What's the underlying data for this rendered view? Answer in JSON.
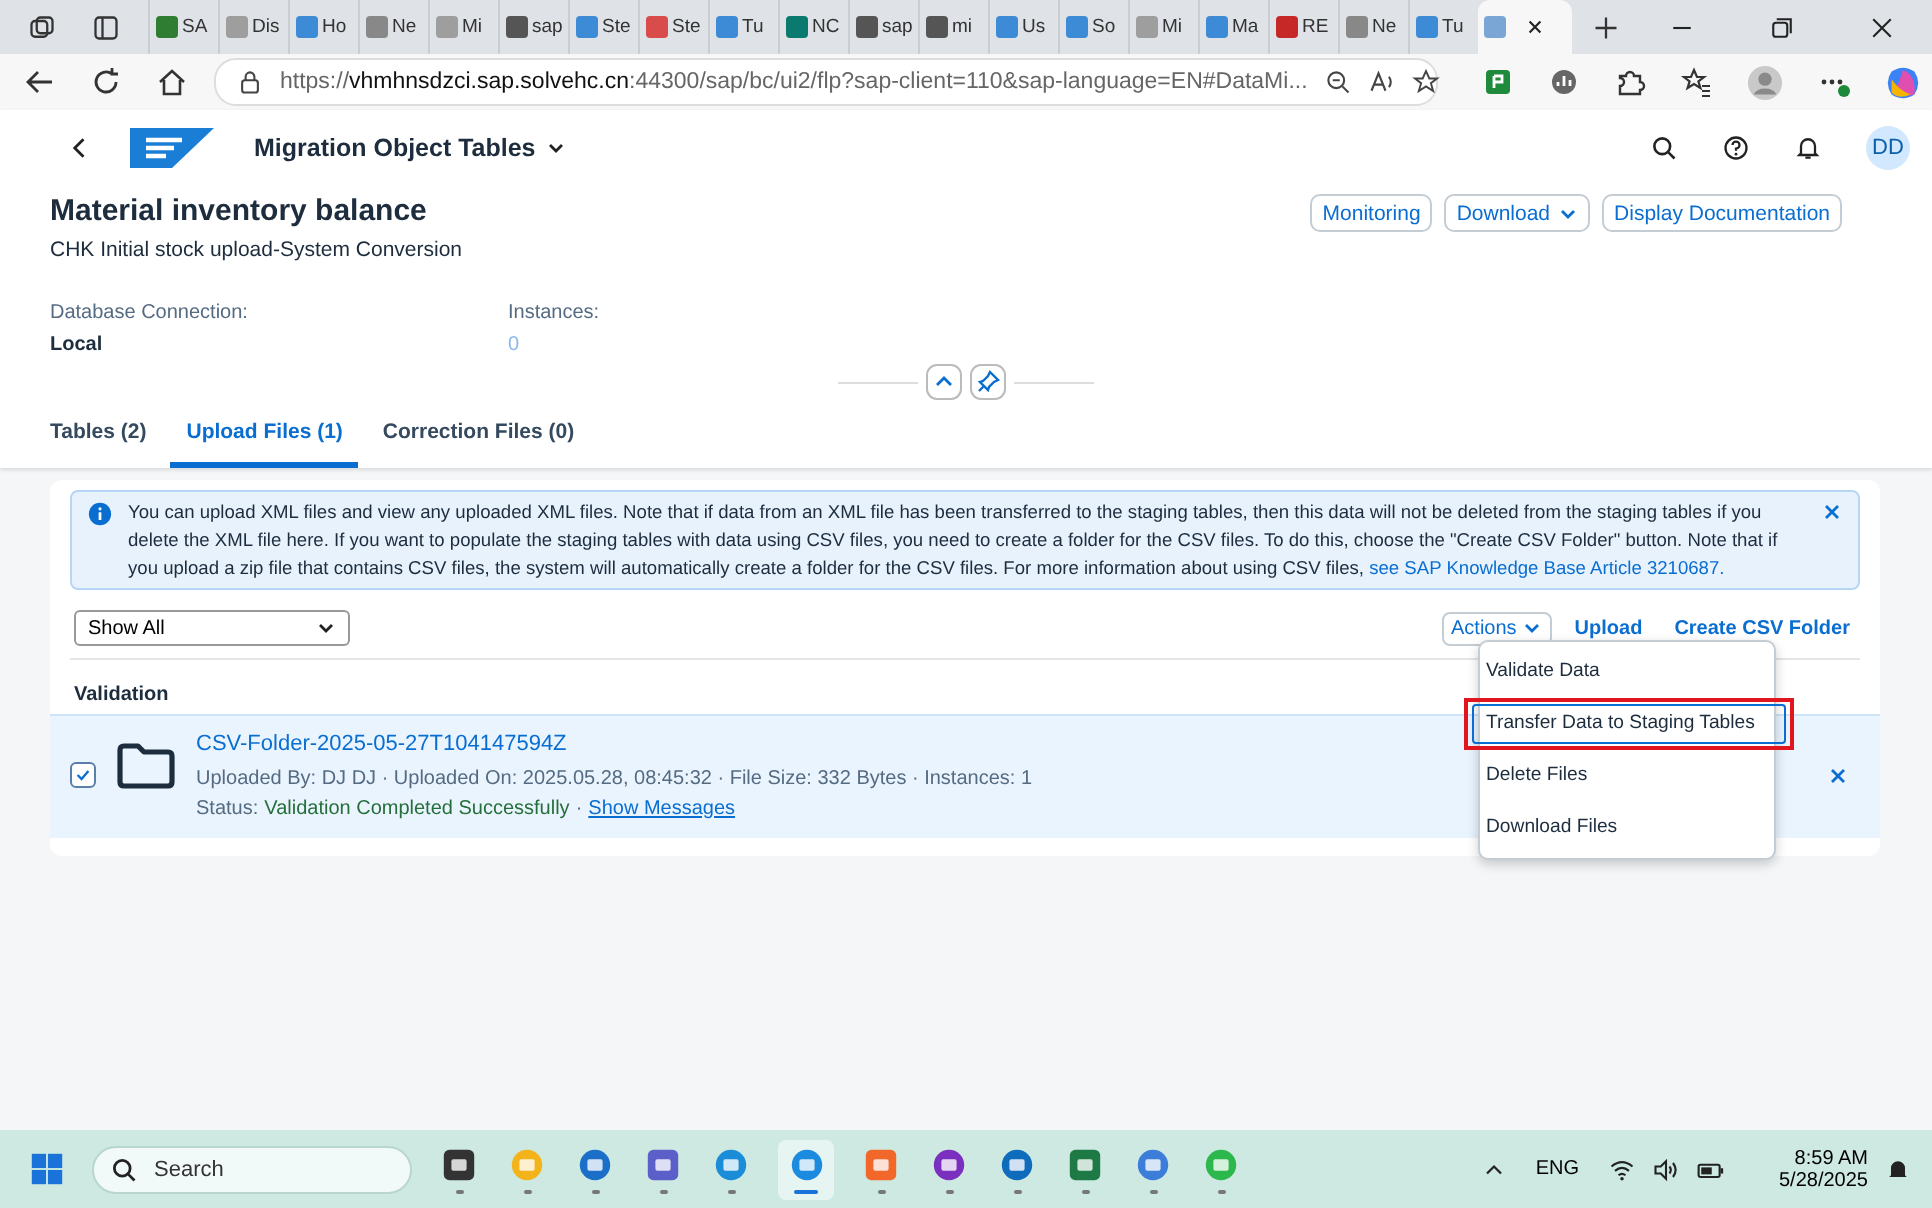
{
  "browser": {
    "tabs": [
      {
        "label": "SA",
        "selected": false
      },
      {
        "label": "Dis",
        "selected": false
      },
      {
        "label": "Ho",
        "selected": false
      },
      {
        "label": "Ne",
        "selected": false
      },
      {
        "label": "Mi",
        "selected": false
      },
      {
        "label": "sap",
        "selected": false
      },
      {
        "label": "Ste",
        "selected": false
      },
      {
        "label": "Ste",
        "selected": false
      },
      {
        "label": "Tu",
        "selected": false
      },
      {
        "label": "NC",
        "selected": false
      },
      {
        "label": "sap",
        "selected": false
      },
      {
        "label": "mi",
        "selected": false
      },
      {
        "label": "Us",
        "selected": false
      },
      {
        "label": "So",
        "selected": false
      },
      {
        "label": "Mi",
        "selected": false
      },
      {
        "label": "Ma",
        "selected": false
      },
      {
        "label": "RE",
        "selected": false
      },
      {
        "label": "Ne",
        "selected": false
      },
      {
        "label": "Tu",
        "selected": false
      },
      {
        "selected": true
      }
    ],
    "url": {
      "scheme": "https://",
      "host": "vhmhnsdzci.sap.solvehc.cn",
      "rest": ":44300/sap/bc/ui2/flp?sap-client=110&sap-language=EN#DataMi..."
    }
  },
  "shell": {
    "app_title": "Migration Object Tables",
    "avatar": "DD"
  },
  "header": {
    "title": "Material inventory balance",
    "subtitle": "CHK Initial stock upload-System Conversion",
    "actions": [
      {
        "label": "Monitoring",
        "kind": "button"
      },
      {
        "label": "Download",
        "kind": "menu"
      },
      {
        "label": "Display Documentation",
        "kind": "button"
      }
    ],
    "attributes": [
      {
        "label": "Database Connection:",
        "value": "Local",
        "kind": "text"
      },
      {
        "label": "Instances:",
        "value": "0",
        "kind": "link"
      }
    ]
  },
  "tabs": [
    {
      "label": "Tables (2)",
      "selected": false
    },
    {
      "label": "Upload Files (1)",
      "selected": true
    },
    {
      "label": "Correction Files (0)",
      "selected": false
    }
  ],
  "info": {
    "text": "You can upload XML files and view any uploaded XML files. Note that if data from an XML file has been transferred to the staging tables, then this data will not be deleted from the staging tables if you delete the XML file here. If you want to populate the staging tables with data using CSV files, you need to create a folder for the CSV files. To do this, choose the \"Create CSV Folder\" button. Note that if you upload a zip file that contains CSV files, the system will automatically create a folder for the CSV files. For more information about using CSV files,",
    "link": "see SAP Knowledge Base Article 3210687."
  },
  "toolbar": {
    "filter": "Show All",
    "actions": [
      {
        "label": "Actions",
        "kind": "menu"
      },
      {
        "label": "Upload",
        "kind": "link"
      },
      {
        "label": "Create CSV Folder",
        "kind": "link"
      }
    ]
  },
  "section_title": "Validation",
  "files": [
    {
      "name": "CSV-Folder-2025-05-27T104147594Z",
      "checked": true,
      "details": "Uploaded By: DJ DJ · Uploaded On: 2025.05.28, 08:45:32 · File Size: 332 Bytes · Instances: 1",
      "status_label": "Status:",
      "status": "Validation Completed Successfully",
      "separator": "·",
      "messages_link": "Show Messages"
    }
  ],
  "menu": {
    "items": [
      {
        "label": "Validate Data",
        "selected": false,
        "highlighted": false
      },
      {
        "label": "Transfer Data to Staging Tables",
        "selected": true,
        "highlighted": true
      },
      {
        "label": "Delete Files",
        "selected": false,
        "highlighted": false
      },
      {
        "label": "Download Files",
        "selected": false,
        "highlighted": false
      }
    ]
  },
  "taskbar": {
    "search": "Search",
    "apps": [
      {
        "selected": false
      },
      {
        "selected": false
      },
      {
        "selected": false
      },
      {
        "selected": false
      },
      {
        "selected": false
      },
      {
        "selected": true
      },
      {
        "selected": false
      },
      {
        "selected": false
      },
      {
        "selected": false
      },
      {
        "selected": false
      },
      {
        "selected": false
      },
      {
        "selected": false
      }
    ],
    "language": "ENG",
    "time": "8:59 AM",
    "date": "5/28/2025"
  }
}
